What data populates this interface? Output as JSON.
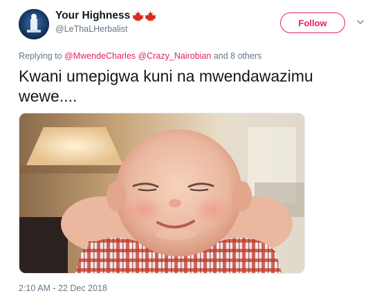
{
  "author": {
    "display_name": "Your Highness",
    "flag_emoji": [
      "maple-leaf-icon",
      "maple-leaf-icon"
    ],
    "handle": "@LeThaLHerbalist"
  },
  "follow_button": {
    "label": "Follow"
  },
  "reply": {
    "prefix": "Replying to",
    "mention_1": "@MwendeCharles",
    "mention_2": "@Crazy_Nairobian",
    "suffix": "and 8 others"
  },
  "tweet": {
    "text": "Kwani umepigwa kuni na mwendawazimu wewe....",
    "timestamp": "2:10 AM - 22 Dec 2018"
  },
  "colors": {
    "accent": "#e0245e",
    "secondary_text": "#657786",
    "primary_text": "#14171a",
    "flag_red": "#d52b1e"
  }
}
